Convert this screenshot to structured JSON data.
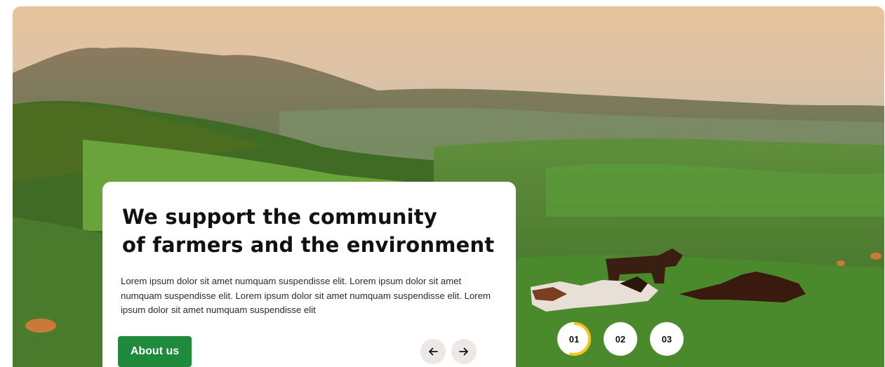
{
  "hero": {
    "title_line1": "We support the community",
    "title_line2": "of farmers and the environment",
    "body": "Lorem ipsum dolor sit amet numquam suspendisse elit. Lorem ipsum dolor sit amet numquam suspendisse elit. Lorem ipsum dolor sit amet numquam suspendisse elit. Lorem ipsum dolor sit amet numquam suspendisse elit",
    "cta_label": "About us",
    "prev_icon": "arrow-left-icon",
    "next_icon": "arrow-right-icon"
  },
  "slides": {
    "items": [
      {
        "label": "01",
        "active": true,
        "progress": 0.55
      },
      {
        "label": "02",
        "active": false
      },
      {
        "label": "03",
        "active": false
      }
    ]
  },
  "colors": {
    "primary_button": "#1f8a3c",
    "progress_ring": "#f5c518",
    "arrow_button_bg": "#ede8e6"
  }
}
